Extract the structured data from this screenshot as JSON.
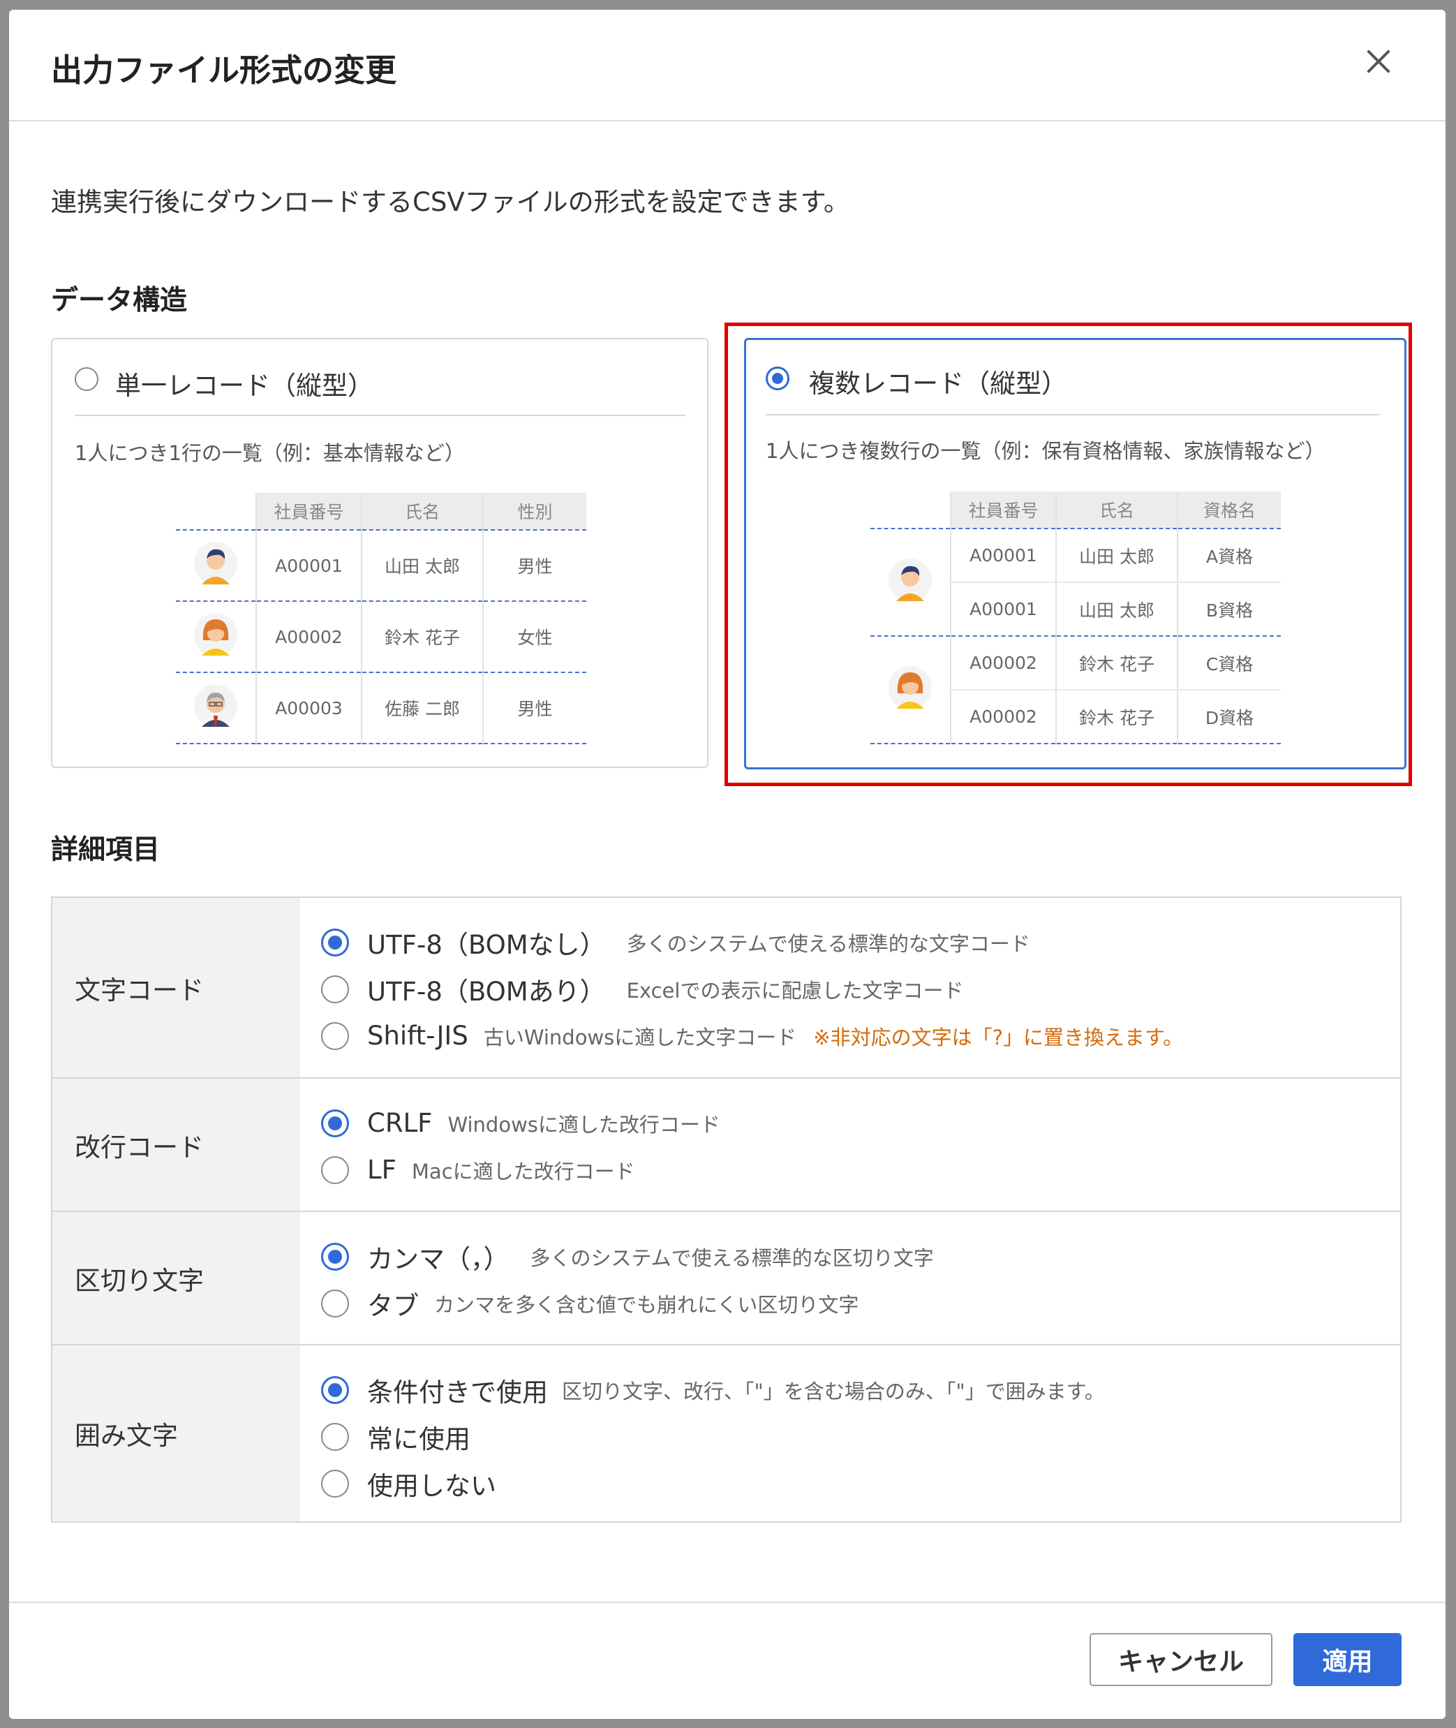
{
  "dialog": {
    "title": "出力ファイル形式の変更",
    "description": "連携実行後にダウンロードするCSVファイルの形式を設定できます。"
  },
  "data_structure": {
    "section_title": "データ構造",
    "single": {
      "label": "単一レコード（縦型）",
      "description": "1人につき1行の一覧（例：基本情報など）",
      "selected": false,
      "headers": [
        "社員番号",
        "氏名",
        "性別"
      ],
      "rows": [
        {
          "avatar": "man-avatar",
          "cells": [
            "A00001",
            "山田 太郎",
            "男性"
          ]
        },
        {
          "avatar": "woman-avatar",
          "cells": [
            "A00002",
            "鈴木 花子",
            "女性"
          ]
        },
        {
          "avatar": "older-man-avatar",
          "cells": [
            "A00003",
            "佐藤 二郎",
            "男性"
          ]
        }
      ]
    },
    "multiple": {
      "label": "複数レコード（縦型）",
      "description": "1人につき複数行の一覧（例：保有資格情報、家族情報など）",
      "selected": true,
      "headers": [
        "社員番号",
        "氏名",
        "資格名"
      ],
      "rows": [
        {
          "cells": [
            "A00001",
            "山田 太郎",
            "A資格"
          ]
        },
        {
          "cells": [
            "A00001",
            "山田 太郎",
            "B資格"
          ]
        },
        {
          "cells": [
            "A00002",
            "鈴木 花子",
            "C資格"
          ]
        },
        {
          "cells": [
            "A00002",
            "鈴木 花子",
            "D資格"
          ]
        }
      ]
    }
  },
  "details": {
    "section_title": "詳細項目",
    "char_code": {
      "label": "文字コード",
      "options": [
        {
          "label": "UTF-8（BOMなし）",
          "note": "多くのシステムで使える標準的な文字コード",
          "selected": true
        },
        {
          "label": "UTF-8（BOMあり）",
          "note": "Excelでの表示に配慮した文字コード",
          "selected": false
        },
        {
          "label": "Shift-JIS",
          "note": "古いWindowsに適した文字コード",
          "warning": "※非対応の文字は「?」に置き換えます。",
          "selected": false
        }
      ]
    },
    "newline": {
      "label": "改行コード",
      "options": [
        {
          "label": "CRLF",
          "note": "Windowsに適した改行コード",
          "selected": true
        },
        {
          "label": "LF",
          "note": "Macに適した改行コード",
          "selected": false
        }
      ]
    },
    "delimiter": {
      "label": "区切り文字",
      "options": [
        {
          "label": "カンマ（，）",
          "note": "多くのシステムで使える標準的な区切り文字",
          "selected": true
        },
        {
          "label": "タブ",
          "note": "カンマを多く含む値でも崩れにくい区切り文字",
          "selected": false
        }
      ]
    },
    "quote": {
      "label": "囲み文字",
      "options": [
        {
          "label": "条件付きで使用",
          "note": "区切り文字、改行、「\"」を含む場合のみ、「\"」で囲みます。",
          "selected": true
        },
        {
          "label": "常に使用",
          "note": "",
          "selected": false
        },
        {
          "label": "使用しない",
          "note": "",
          "selected": false
        }
      ]
    }
  },
  "footer": {
    "cancel_label": "キャンセル",
    "apply_label": "適用"
  },
  "colors": {
    "accent": "#2f6ad8",
    "highlight": "#e00000",
    "warning": "#d46b08"
  }
}
